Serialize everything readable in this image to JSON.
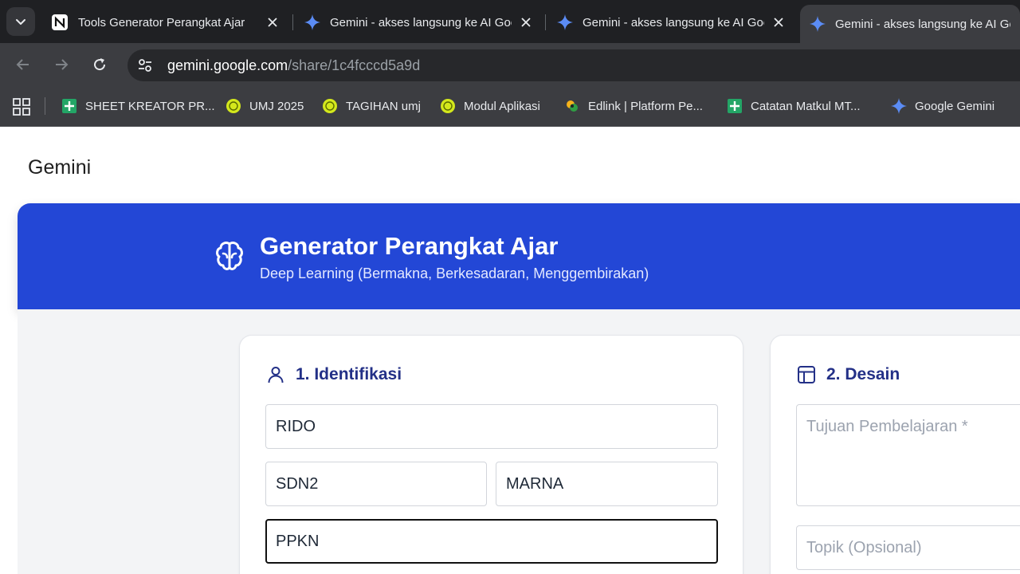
{
  "browser": {
    "tabs": [
      {
        "title": "Tools Generator Perangkat Ajar",
        "icon": "notion-icon",
        "active": false
      },
      {
        "title": "Gemini - akses langsung ke AI Google",
        "icon": "gemini-icon",
        "active": false
      },
      {
        "title": "Gemini - akses langsung ke AI Google",
        "icon": "gemini-icon",
        "active": false
      },
      {
        "title": "Gemini - akses langsung ke AI Google",
        "icon": "gemini-icon",
        "active": true
      }
    ],
    "url_host": "gemini.google.com",
    "url_path": "/share/1c4fcccd5a9d",
    "bookmarks": [
      {
        "label": "SHEET KREATOR PR...",
        "icon": "sheets-icon"
      },
      {
        "label": "UMJ 2025",
        "icon": "umj-logo-icon"
      },
      {
        "label": "TAGIHAN umj",
        "icon": "umj-logo-icon"
      },
      {
        "label": "Modul Aplikasi",
        "icon": "umj-logo-icon"
      },
      {
        "label": "Edlink | Platform Pe...",
        "icon": "edlink-icon"
      },
      {
        "label": "Catatan Matkul MT...",
        "icon": "sheets-icon"
      },
      {
        "label": "Google Gemini",
        "icon": "gemini-icon"
      }
    ]
  },
  "page": {
    "brand": "Gemini",
    "hero": {
      "title": "Generator Perangkat Ajar",
      "subtitle": "Deep Learning (Bermakna, Berkesadaran, Menggembirakan)",
      "icon": "brain-icon"
    },
    "identifikasi": {
      "title": "1. Identifikasi",
      "icon": "user-icon",
      "field_name": "RIDO",
      "field_school": "SDN2",
      "field_other": "MARNA",
      "field_subject": "PPKN"
    },
    "desain": {
      "title": "2. Desain",
      "icon": "layout-icon",
      "tujuan_placeholder": "Tujuan Pembelajaran *",
      "topik_placeholder": "Topik (Opsional)"
    }
  },
  "colors": {
    "hero_bg": "#2347d6",
    "heading": "#233087",
    "chrome_dark": "#1f2023",
    "chrome_toolbar": "#3c3d41"
  }
}
